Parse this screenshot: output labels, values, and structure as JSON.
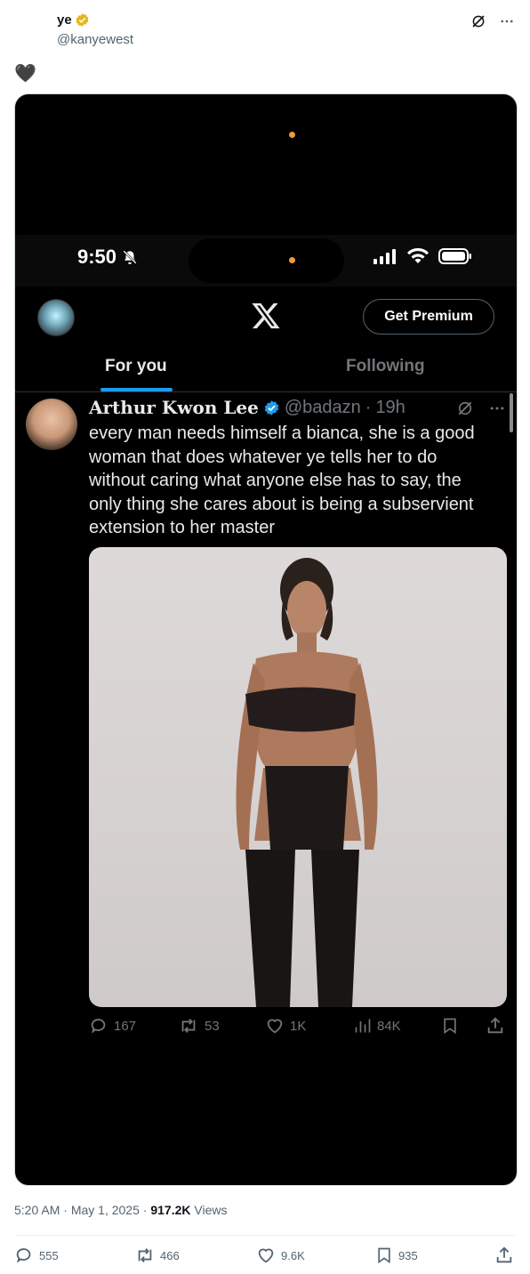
{
  "author": {
    "name": "ye",
    "handle": "@kanyewest",
    "verified": true
  },
  "tweet": {
    "text": "🖤"
  },
  "embedded_screenshot": {
    "status_bar": {
      "time": "9:50"
    },
    "header": {
      "premium_label": "Get Premium"
    },
    "tabs": [
      {
        "label": "For you",
        "active": true
      },
      {
        "label": "Following",
        "active": false
      }
    ],
    "post": {
      "author_name": "Arthur Kwon Lee",
      "handle": "@badazn",
      "separator": "·",
      "time_ago": "19h",
      "text": "every man needs himself a bianca, she is a good woman that does whatever ye tells her to do without caring what anyone else has to say, the only thing she cares about is being a subservient extension to her master",
      "actions": {
        "replies": "167",
        "reposts": "53",
        "likes": "1K",
        "views": "84K"
      }
    }
  },
  "meta": {
    "time": "5:20 AM",
    "dot1": "·",
    "date": "May 1, 2025",
    "dot2": "·",
    "views_count": "917.2K",
    "views_label": "Views"
  },
  "actions": {
    "replies": "555",
    "reposts": "466",
    "likes": "9.6K",
    "bookmarks": "935"
  },
  "colors": {
    "accent": "#1d9bf0",
    "gold_badge": "#e2b719",
    "text_secondary": "#536471"
  }
}
